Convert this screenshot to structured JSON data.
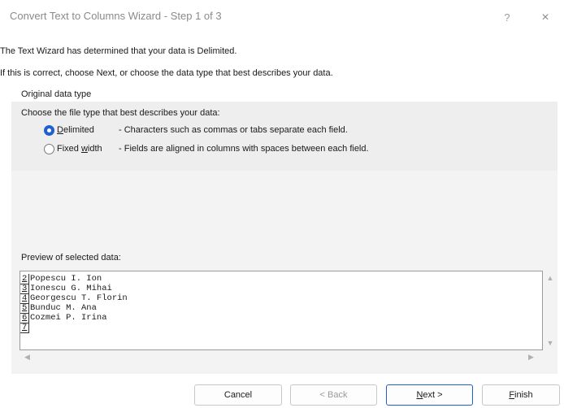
{
  "window": {
    "title": "Convert Text to Columns Wizard - Step 1 of 3",
    "help_icon": "?",
    "close_icon": "×"
  },
  "intro": {
    "line1": "The Text Wizard has determined that your data is Delimited.",
    "line2": "If this is correct, choose Next, or choose the data type that best describes your data."
  },
  "original_type": {
    "group_title": "Original data type",
    "prompt": "Choose the file type that best describes your data:",
    "options": [
      {
        "label": "Delimited",
        "underline": "D",
        "description": "- Characters such as commas or tabs separate each field.",
        "selected": true
      },
      {
        "label": "Fixed width",
        "underline": "w",
        "description": "- Fields are aligned in columns with spaces between each field.",
        "selected": false
      }
    ]
  },
  "preview": {
    "label": "Preview of selected data:",
    "rows": [
      {
        "num": "2",
        "text": "Popescu I. Ion"
      },
      {
        "num": "3",
        "text": "Ionescu G. Mihai"
      },
      {
        "num": "4",
        "text": "Georgescu T. Florin"
      },
      {
        "num": "5",
        "text": "Bunduc M. Ana"
      },
      {
        "num": "6",
        "text": "Cozmei P. Irina"
      },
      {
        "num": "7",
        "text": ""
      }
    ]
  },
  "buttons": {
    "cancel": "Cancel",
    "back": "< Back",
    "next": "Next >",
    "finish": "Finish"
  },
  "colors": {
    "accent": "#1f5fcf"
  }
}
